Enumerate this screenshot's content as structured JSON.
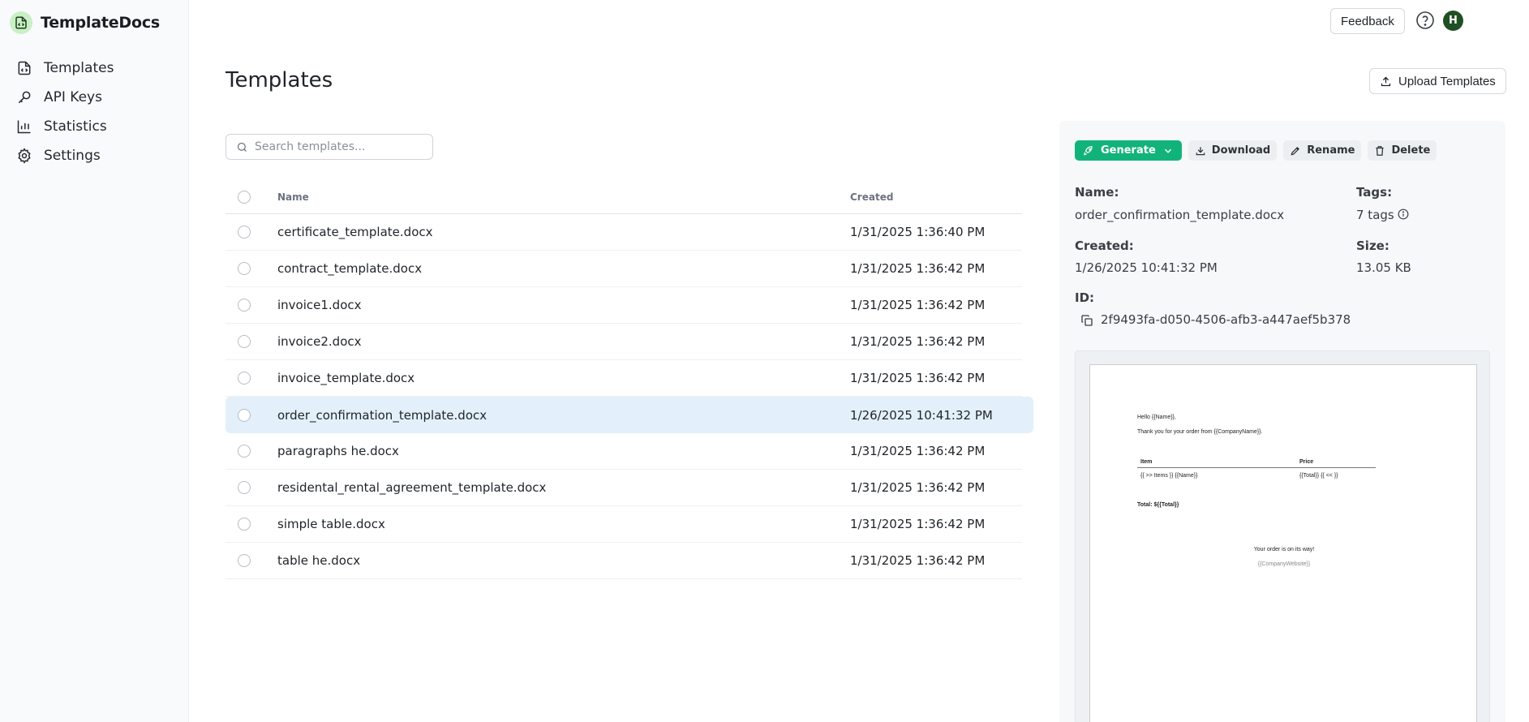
{
  "app": {
    "name": "TemplateDocs"
  },
  "sidebar": {
    "items": [
      {
        "label": "Templates",
        "icon": "file-code-icon"
      },
      {
        "label": "API Keys",
        "icon": "key-icon"
      },
      {
        "label": "Statistics",
        "icon": "bar-chart-icon"
      },
      {
        "label": "Settings",
        "icon": "gear-icon"
      }
    ]
  },
  "topbar": {
    "feedback_label": "Feedback",
    "avatar_initial": "H"
  },
  "main": {
    "title": "Templates",
    "upload_label": "Upload Templates",
    "search_placeholder": "Search templates...",
    "columns": {
      "name": "Name",
      "created": "Created"
    },
    "rows": [
      {
        "name": "certificate_template.docx",
        "created": "1/31/2025 1:36:40 PM"
      },
      {
        "name": "contract_template.docx",
        "created": "1/31/2025 1:36:42 PM"
      },
      {
        "name": "invoice1.docx",
        "created": "1/31/2025 1:36:42 PM"
      },
      {
        "name": "invoice2.docx",
        "created": "1/31/2025 1:36:42 PM"
      },
      {
        "name": "invoice_template.docx",
        "created": "1/31/2025 1:36:42 PM"
      },
      {
        "name": "order_confirmation_template.docx",
        "created": "1/26/2025 10:41:32 PM"
      },
      {
        "name": "paragraphs he.docx",
        "created": "1/31/2025 1:36:42 PM"
      },
      {
        "name": "residental_rental_agreement_template.docx",
        "created": "1/31/2025 1:36:42 PM"
      },
      {
        "name": "simple table.docx",
        "created": "1/31/2025 1:36:42 PM"
      },
      {
        "name": "table he.docx",
        "created": "1/31/2025 1:36:42 PM"
      }
    ],
    "selected_row": "order_confirmation_template.docx"
  },
  "panel": {
    "actions": {
      "generate": "Generate",
      "download": "Download",
      "rename": "Rename",
      "delete": "Delete"
    },
    "name_label": "Name:",
    "name_value": "order_confirmation_template.docx",
    "tags_label": "Tags:",
    "tags_value": "7 tags",
    "created_label": "Created:",
    "created_value": "1/26/2025 10:41:32 PM",
    "size_label": "Size:",
    "size_value": "13.05 KB",
    "id_label": "ID:",
    "id_value": "2f9493fa-d050-4506-afb3-a447aef5b378",
    "preview": {
      "line1": "Hello {{Name}},",
      "line2": "Thank you for your order from {{CompanyName}}.",
      "table_headers": [
        "Item",
        "Price"
      ],
      "table_row": [
        "{{ >> Items }} {{Name}}",
        "{{Total}} {{ << }}"
      ],
      "total": "Total: ${{Total}}",
      "footer1": "Your order is on its way!",
      "footer2": "{{CompanyWebsite}}"
    }
  },
  "colors": {
    "accent": "#12b37a",
    "selected_row": "#e3f0fb",
    "avatar": "#1f4f22"
  }
}
